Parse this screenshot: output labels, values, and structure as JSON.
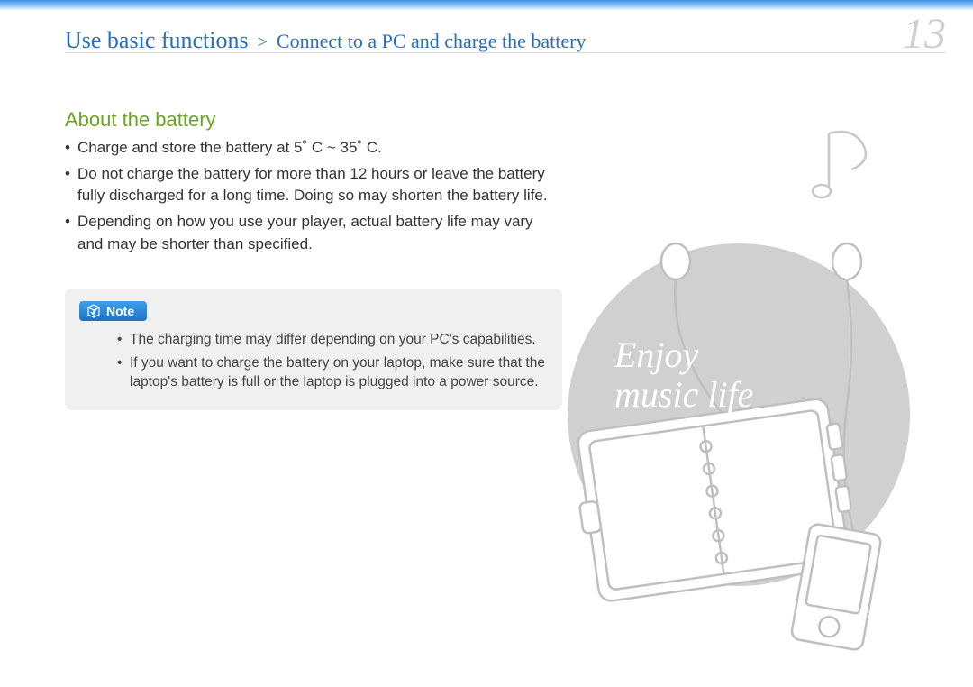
{
  "header": {
    "breadcrumb_main": "Use basic functions",
    "breadcrumb_sep": ">",
    "breadcrumb_sub": "Connect to a PC and charge the battery",
    "page_number": "13"
  },
  "section": {
    "title": "About the battery",
    "bullets": [
      "Charge and store the battery at 5˚ C ~ 35˚ C.",
      "Do not charge the battery for more than 12 hours or leave the battery fully discharged for a long time. Doing so may shorten the battery life.",
      "Depending on how you use your player, actual battery life may vary and may be shorter than specified."
    ]
  },
  "note": {
    "label": "Note",
    "items": [
      "The charging time may differ depending on your PC's capabilities.",
      "If you want to charge the battery on your laptop, make sure that the laptop's battery is full or the laptop is plugged into a power source."
    ]
  },
  "illustration": {
    "caption_line1": "Enjoy",
    "caption_line2": "music life"
  }
}
